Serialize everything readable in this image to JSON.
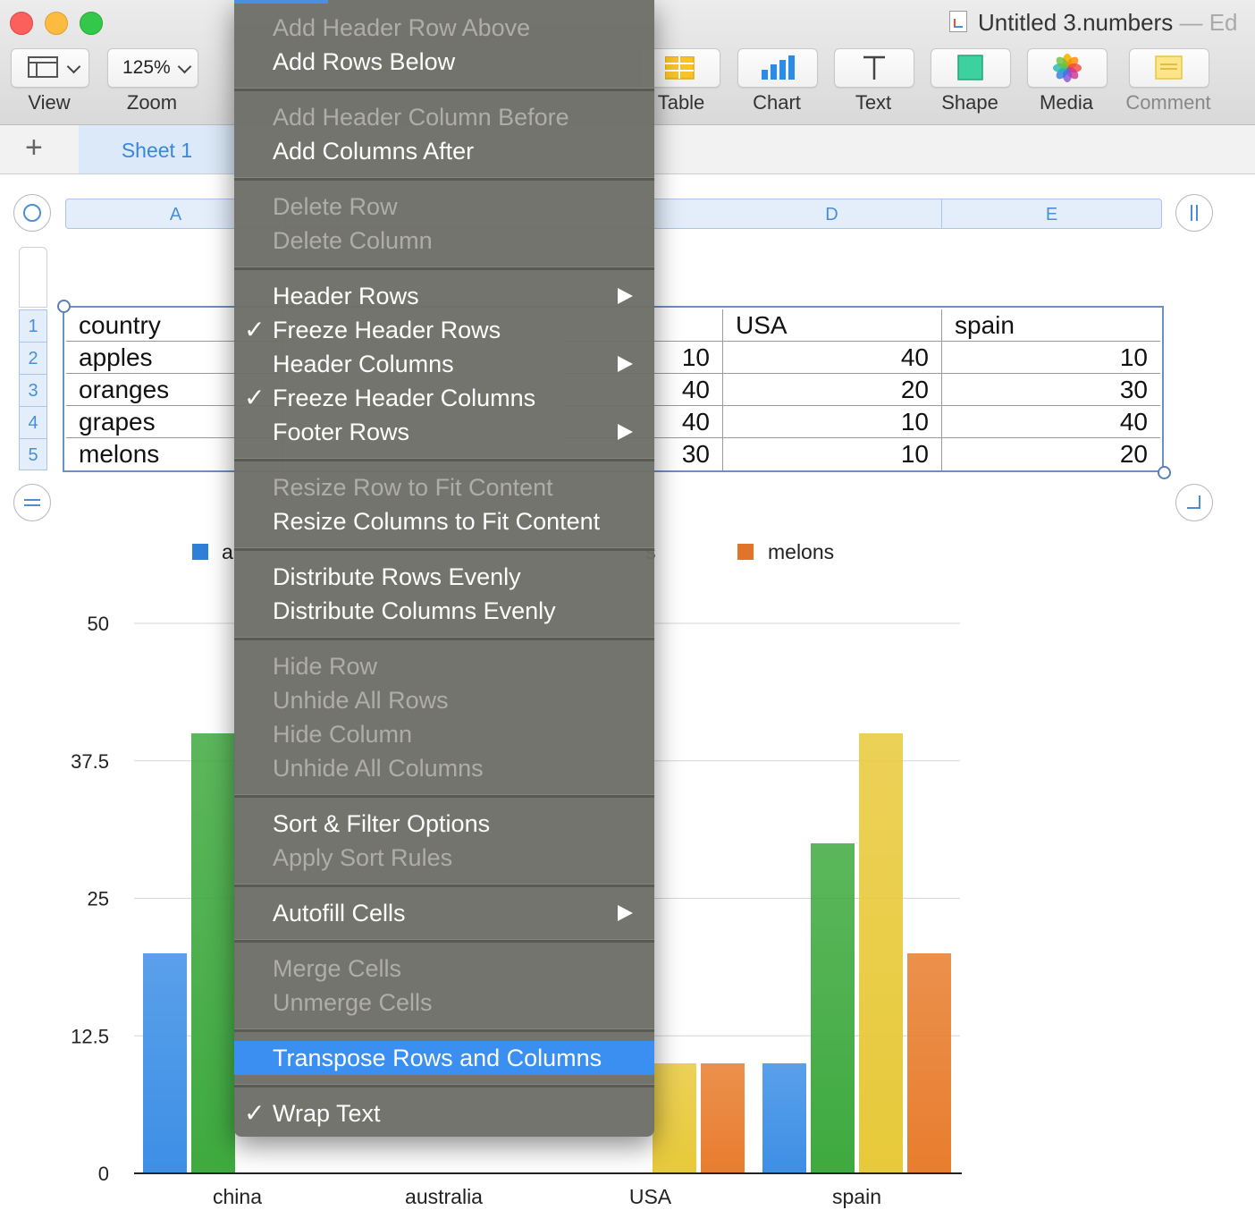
{
  "window": {
    "title": "Untitled 3.numbers",
    "title_suffix": "— Ed"
  },
  "toolbar": {
    "view_label": "View",
    "zoom_value": "125%",
    "zoom_label": "Zoom",
    "table_label": "Table",
    "chart_label": "Chart",
    "text_label": "Text",
    "shape_label": "Shape",
    "media_label": "Media",
    "comment_label": "Comment"
  },
  "tabs": {
    "add_symbol": "+",
    "sheet_name": "Sheet 1"
  },
  "table": {
    "visible_column_headers": [
      "A",
      "D",
      "E"
    ],
    "row_numbers": [
      "1",
      "2",
      "3",
      "4",
      "5"
    ],
    "col_a": [
      "country",
      "apples",
      "oranges",
      "grapes",
      "melons"
    ],
    "col_c_partial": [
      "",
      "10",
      "40",
      "40",
      "30"
    ],
    "col_d": [
      "USA",
      "40",
      "20",
      "10",
      "10"
    ],
    "col_e": [
      "spain",
      "10",
      "30",
      "40",
      "20"
    ]
  },
  "chart_data": {
    "type": "bar",
    "categories": [
      "china",
      "australia",
      "USA",
      "spain"
    ],
    "series": [
      {
        "values": [
          20,
          null,
          null,
          10
        ],
        "color": "#3d8fe6"
      },
      {
        "name": "",
        "values": [
          40,
          null,
          null,
          30
        ],
        "color": "#3faa3f"
      },
      {
        "name": "",
        "values": [
          null,
          null,
          10,
          40
        ],
        "color": "#e8c93a"
      },
      {
        "name": "melons",
        "values": [
          null,
          null,
          10,
          20
        ],
        "color": "#e87d2e"
      }
    ],
    "legend_visible_labels": [
      "a",
      "s",
      "melons"
    ],
    "y_ticks": [
      "50",
      "37.5",
      "25",
      "12.5",
      "0"
    ],
    "ylim": [
      0,
      50
    ],
    "grid": true
  },
  "menu": {
    "items": [
      {
        "label": "Add Header Row Above",
        "enabled": false
      },
      {
        "label": "Add Rows Below",
        "enabled": true
      },
      {
        "label": "Add Header Column Before",
        "enabled": false
      },
      {
        "label": "Add Columns After",
        "enabled": true
      },
      {
        "label": "Delete Row",
        "enabled": false
      },
      {
        "label": "Delete Column",
        "enabled": false
      },
      {
        "label": "Header Rows",
        "enabled": true,
        "submenu": true
      },
      {
        "label": "Freeze Header Rows",
        "enabled": true,
        "checked": true
      },
      {
        "label": "Header Columns",
        "enabled": true,
        "submenu": true
      },
      {
        "label": "Freeze Header Columns",
        "enabled": true,
        "checked": true
      },
      {
        "label": "Footer Rows",
        "enabled": true,
        "submenu": true
      },
      {
        "label": "Resize Row to Fit Content",
        "enabled": false
      },
      {
        "label": "Resize Columns to Fit Content",
        "enabled": true
      },
      {
        "label": "Distribute Rows Evenly",
        "enabled": true
      },
      {
        "label": "Distribute Columns Evenly",
        "enabled": true
      },
      {
        "label": "Hide Row",
        "enabled": false
      },
      {
        "label": "Unhide All Rows",
        "enabled": false
      },
      {
        "label": "Hide Column",
        "enabled": false
      },
      {
        "label": "Unhide All Columns",
        "enabled": false
      },
      {
        "label": "Sort & Filter Options",
        "enabled": true
      },
      {
        "label": "Apply Sort Rules",
        "enabled": false
      },
      {
        "label": "Autofill Cells",
        "enabled": true,
        "submenu": true
      },
      {
        "label": "Merge Cells",
        "enabled": false
      },
      {
        "label": "Unmerge Cells",
        "enabled": false
      },
      {
        "label": "Transpose Rows and Columns",
        "enabled": true,
        "highlighted": true
      },
      {
        "label": "Wrap Text",
        "enabled": true,
        "checked": true
      }
    ],
    "check_symbol": "✓"
  }
}
